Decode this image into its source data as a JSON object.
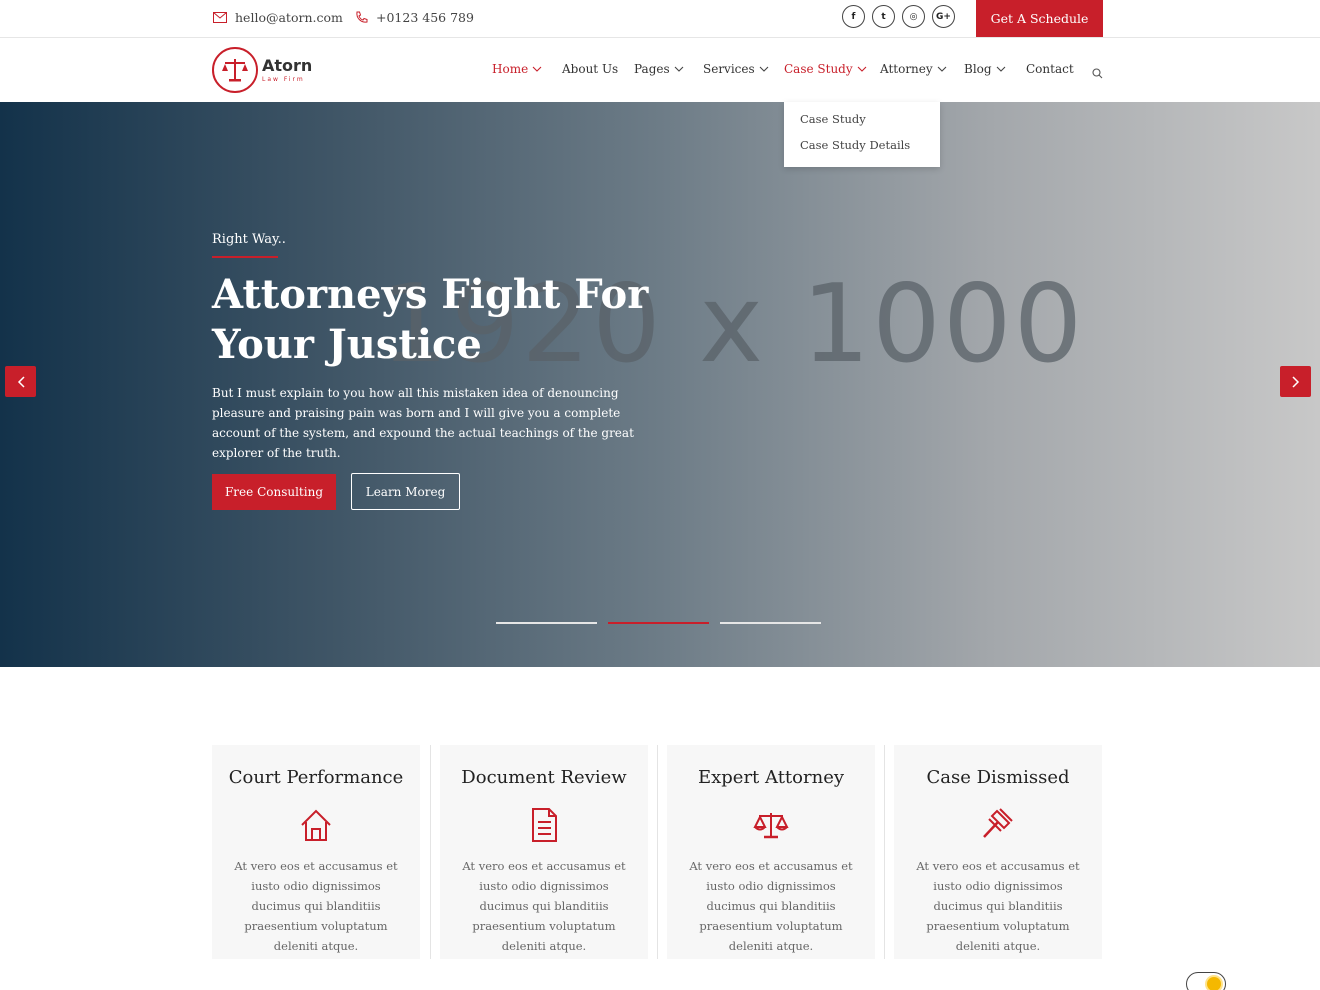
{
  "topbar": {
    "email": "hello@atorn.com",
    "phone": "+0123 456 789",
    "social": [
      {
        "icon": "facebook-icon",
        "glyph": "f"
      },
      {
        "icon": "twitter-icon",
        "glyph": "t"
      },
      {
        "icon": "instagram-icon",
        "glyph": "◎"
      },
      {
        "icon": "google-plus-icon",
        "glyph": "G+"
      }
    ],
    "schedule_label": "Get A Schedule"
  },
  "brand": {
    "name": "Atorn",
    "tagline": "Law Firm"
  },
  "nav": {
    "items": [
      {
        "label": "Home",
        "has_dropdown": true,
        "active": true
      },
      {
        "label": "About Us",
        "has_dropdown": false
      },
      {
        "label": "Pages",
        "has_dropdown": true
      },
      {
        "label": "Services",
        "has_dropdown": true
      },
      {
        "label": "Case Study",
        "has_dropdown": true,
        "highlighted": true
      },
      {
        "label": "Attorney",
        "has_dropdown": true
      },
      {
        "label": "Blog",
        "has_dropdown": true
      },
      {
        "label": "Contact",
        "has_dropdown": false
      }
    ],
    "dropdown": [
      "Case Study",
      "Case Study Details"
    ]
  },
  "hero": {
    "eyebrow": "Right Way..",
    "title": "Attorneys Fight For Your Justice",
    "text": "But I must explain to you how all this mistaken idea of denouncing pleasure and praising pain was born and I will give you a complete account of the system, and expound the actual teachings of the great explorer of the truth.",
    "primary_button": "Free Consulting",
    "secondary_button": "Learn Moreg",
    "placeholder_text": "1920 x 1000",
    "active_slide": 2,
    "slide_count": 3
  },
  "features": [
    {
      "title": "Court Performance",
      "icon": "house-icon",
      "text": "At vero eos et accusamus et iusto odio dignissimos ducimus qui blanditiis praesentium voluptatum deleniti atque."
    },
    {
      "title": "Document Review",
      "icon": "document-icon",
      "text": "At vero eos et accusamus et iusto odio dignissimos ducimus qui blanditiis praesentium voluptatum deleniti atque."
    },
    {
      "title": "Expert Attorney",
      "icon": "scales-icon",
      "text": "At vero eos et accusamus et iusto odio dignissimos ducimus qui blanditiis praesentium voluptatum deleniti atque."
    },
    {
      "title": "Case Dismissed",
      "icon": "gavel-icon",
      "text": "At vero eos et accusamus et iusto odio dignissimos ducimus qui blanditiis praesentium voluptatum deleniti atque."
    }
  ],
  "colors": {
    "accent": "#c81f2a",
    "hero_dark": "#13324a",
    "card_bg": "#f7f7f7"
  }
}
